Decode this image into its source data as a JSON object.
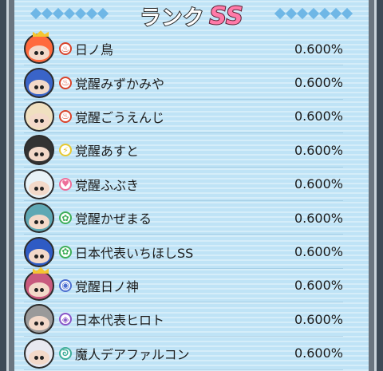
{
  "header": {
    "title": "ランク",
    "rank": "SS"
  },
  "rows": [
    {
      "name": "日ノ鳥",
      "rate": "0.600%",
      "avatar_color": "#ff6a3d",
      "attr_color": "#d9432a",
      "attr_icon": "fire-icon"
    },
    {
      "name": "覚醒みずかみや",
      "rate": "0.600%",
      "avatar_color": "#3a64c8",
      "attr_color": "#d9432a",
      "attr_icon": "fire-icon"
    },
    {
      "name": "覚醒ごうえんじ",
      "rate": "0.600%",
      "avatar_color": "#f0e0c0",
      "attr_color": "#d9432a",
      "attr_icon": "fire-icon"
    },
    {
      "name": "覚醒あすと",
      "rate": "0.600%",
      "avatar_color": "#333333",
      "attr_color": "#e8c930",
      "attr_icon": "lightning-icon"
    },
    {
      "name": "覚醒ふぶき",
      "rate": "0.600%",
      "avatar_color": "#e8f2f7",
      "attr_color": "#ee6f9a",
      "attr_icon": "heart-icon"
    },
    {
      "name": "覚醒かぜまる",
      "rate": "0.600%",
      "avatar_color": "#5fa8b4",
      "attr_color": "#3fae5a",
      "attr_icon": "wind-icon"
    },
    {
      "name": "日本代表いちほしSS",
      "rate": "0.600%",
      "avatar_color": "#2f5bc4",
      "attr_color": "#3fae5a",
      "attr_icon": "wind-icon"
    },
    {
      "name": "覚醒日ノ神",
      "rate": "0.600%",
      "avatar_color": "#c85a7e",
      "attr_color": "#4d6fd0",
      "attr_icon": "water-icon"
    },
    {
      "name": "日本代表ヒロト",
      "rate": "0.600%",
      "avatar_color": "#9a9a9a",
      "attr_color": "#8a56c8",
      "attr_icon": "eye-icon"
    },
    {
      "name": "魔人デアファルコン",
      "rate": "0.600%",
      "avatar_color": "#e8e8f0",
      "attr_color": "#3fae9a",
      "attr_icon": "swirl-icon"
    }
  ]
}
